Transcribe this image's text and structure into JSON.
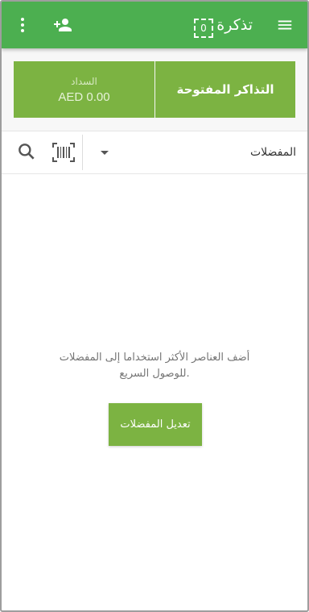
{
  "appbar": {
    "title": "تذكرة",
    "ticket_count": "0",
    "icons": {
      "menu": "menu-icon",
      "add_customer": "person-add-icon",
      "more": "more-vert-icon"
    }
  },
  "summary": {
    "open_tickets_label": "التذاكر المفتوحة",
    "pay_label": "السداد",
    "pay_amount": "AED 0.00"
  },
  "filter": {
    "category": "المفضلات",
    "icons": {
      "dropdown": "dropdown-arrow-icon",
      "barcode": "barcode-scanner-icon",
      "search": "search-icon"
    }
  },
  "empty_state": {
    "line1": "أضف العناصر الأكثر استخداما إلى المفضلات",
    "line2": "للوصول السريع.",
    "edit_button": "تعديل المفضلات"
  },
  "colors": {
    "appbar": "#4caf50",
    "accent": "#7cb342",
    "text_muted": "#757575"
  }
}
